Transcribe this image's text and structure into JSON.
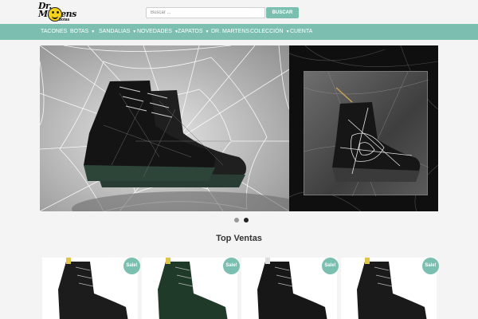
{
  "header": {
    "logo_brand": "Dr. Martens",
    "logo_sub": "botas",
    "search_placeholder": "Buscar ...",
    "search_button": "BUSCAR"
  },
  "nav": {
    "items": [
      {
        "label": "TACONES",
        "dropdown": false
      },
      {
        "label": "BOTAS",
        "dropdown": true
      },
      {
        "label": "SANDALIAS",
        "dropdown": true
      },
      {
        "label": "NOVEDADES",
        "dropdown": true
      },
      {
        "label": "ZAPATOS",
        "dropdown": true
      },
      {
        "label": "DR. MARTENS",
        "dropdown": false
      },
      {
        "label": "COLECCIÓN",
        "dropdown": true
      },
      {
        "label": "CUENTA",
        "dropdown": false
      }
    ],
    "caret_icon": "chevron-down-icon",
    "color": "#7cbfb0"
  },
  "slider": {
    "slide_count": 2,
    "active_slide": 2,
    "dot_inactive_color": "#999999",
    "dot_active_color": "#222222"
  },
  "section": {
    "title": "Top Ventas"
  },
  "products": [
    {
      "badge": "Sale!",
      "boot_color": "#1c1c1c",
      "lace_tag": "#e0c44a"
    },
    {
      "badge": "Sale!",
      "boot_color": "#1f3a28",
      "lace_tag": "#e0c44a"
    },
    {
      "badge": "Sale!",
      "boot_color": "#171717",
      "lace_tag": "#dddddd"
    },
    {
      "badge": "Sale!",
      "boot_color": "#1a1a1a",
      "lace_tag": "#e0c44a"
    }
  ],
  "colors": {
    "accent": "#7bbfb0",
    "background": "#f4f4f4"
  }
}
